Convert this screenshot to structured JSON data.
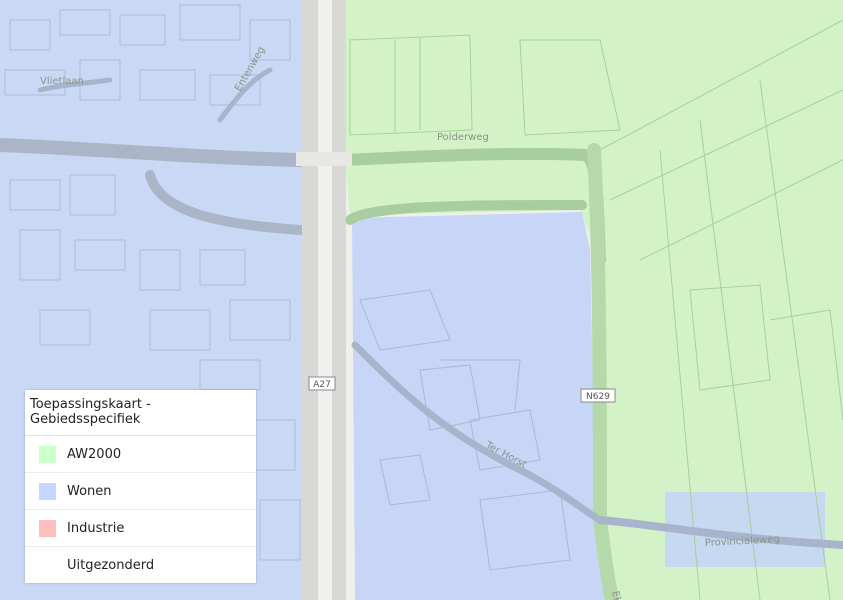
{
  "map": {
    "labels": {
      "ventaan": "Vlietlaan",
      "entenweg": "Entenweg",
      "polderweg": "Polderweg",
      "te_horst": "Ter Horst",
      "provincialeweg": "Provincialeweg",
      "ekste": "Ekste"
    },
    "shields": {
      "a27": "A27",
      "n629": "N629"
    }
  },
  "legend": {
    "title": "Toepassingskaart - Gebiedsspecifiek",
    "items": [
      {
        "label": "AW2000",
        "color": "#ccffcc"
      },
      {
        "label": "Wonen",
        "color": "#c5d6ff"
      },
      {
        "label": "Industrie",
        "color": "#ffc0c0"
      },
      {
        "label": "Uitgezonderd",
        "color": "#ffffff"
      }
    ]
  },
  "colors": {
    "aw2000_fill": "#d2f3c7",
    "wonen_fill": "#c8d7f7",
    "road": "#b4bcc4",
    "highway": "#e8e8e4"
  }
}
